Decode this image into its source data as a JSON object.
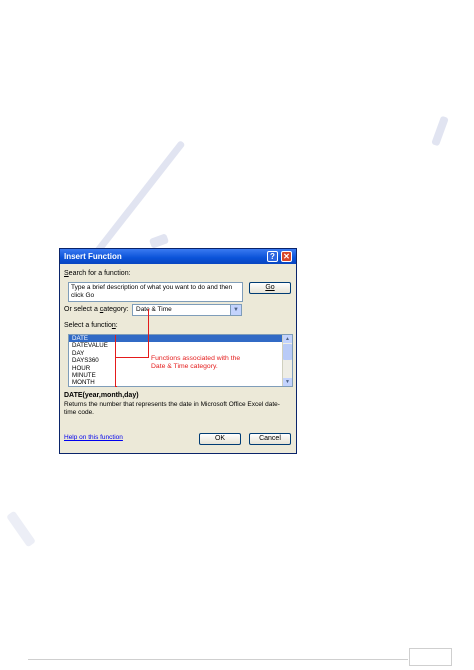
{
  "dialog": {
    "title": "Insert Function",
    "help_button": "?",
    "close_button": "✕",
    "search_label_first": "S",
    "search_label_rest": "earch for a function:",
    "search_value": "Type a brief description of what you want to do and then click Go",
    "go_label": "Go",
    "category_label_before": "Or select a ",
    "category_label_u": "c",
    "category_label_after": "ategory:",
    "category_value": "Date & Time",
    "select_label_before": "Select a functio",
    "select_label_u": "n",
    "select_label_after": ":",
    "functions": [
      "DATE",
      "DATEVALUE",
      "DAY",
      "DAYS360",
      "HOUR",
      "MINUTE",
      "MONTH"
    ],
    "selected_function_index": 0,
    "annotation_line1": "Functions associated with the",
    "annotation_line2": "Date & Time category.",
    "signature": "DATE(year,month,day)",
    "description": "Returns the number that represents the date in Microsoft Office Excel date-time code.",
    "help_link": "Help on this function",
    "ok_label": "OK",
    "cancel_label": "Cancel"
  },
  "colors": {
    "title_bar": "#0a52d8",
    "selection": "#316ac5",
    "annotation": "#e41b1b",
    "dialog_bg": "#ece9d8"
  }
}
